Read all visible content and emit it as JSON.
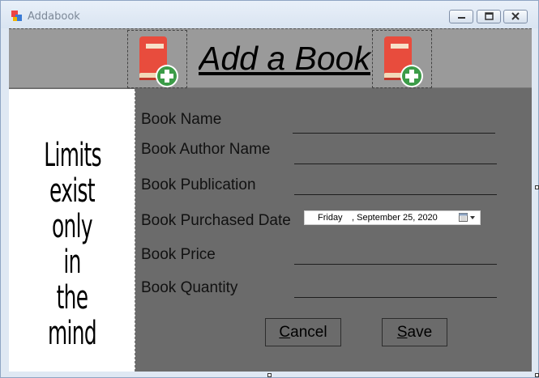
{
  "window": {
    "title": "Addabook",
    "controls": [
      "minimize",
      "maximize",
      "close"
    ]
  },
  "header": {
    "title": "Add a Book",
    "left_icon": "book-add-icon",
    "right_icon": "book-add-icon"
  },
  "left_panel": {
    "quote_lines": [
      "Limits",
      "exist",
      "only in",
      "the mind"
    ]
  },
  "form": {
    "book_name_label": "Book Name",
    "book_name_value": "",
    "author_label": "Book Author Name",
    "author_value": "",
    "publication_label": "Book Publication",
    "publication_value": "",
    "purchased_date_label": "Book Purchased Date",
    "purchased_date_day": "Friday",
    "purchased_date_date": ", September 25, 2020",
    "price_label": "Book Price",
    "price_value": "",
    "quantity_label": "Book Quantity",
    "quantity_value": ""
  },
  "buttons": {
    "cancel_first": "C",
    "cancel_rest": "ancel",
    "save_first": "S",
    "save_rest": "ave"
  },
  "colors": {
    "header_bg": "#9a9a9a",
    "form_bg": "#6b6b6b",
    "book_red": "#e84c3d",
    "plus_green": "#3c9c48"
  }
}
